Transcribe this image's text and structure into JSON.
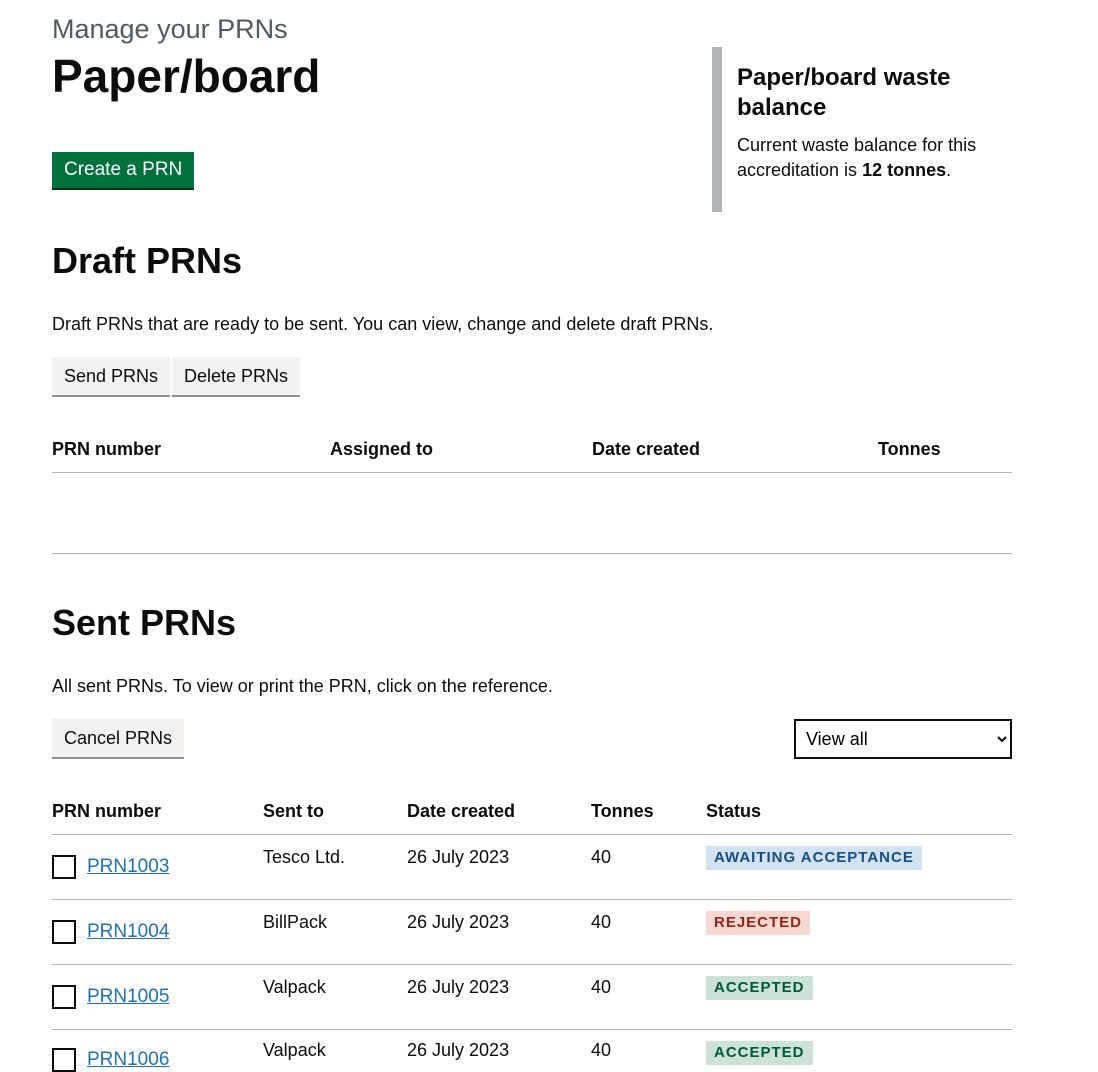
{
  "header": {
    "caption": "Manage your PRNs",
    "title": "Paper/board",
    "create_button": "Create a PRN"
  },
  "balance": {
    "heading": "Paper/board waste balance",
    "text_before": "Current waste balance for this accreditation is ",
    "amount": "12 tonnes",
    "text_after": "."
  },
  "draft": {
    "heading": "Draft PRNs",
    "description": "Draft PRNs that are ready to be sent. You can view, change and delete draft PRNs.",
    "send_button": "Send PRNs",
    "delete_button": "Delete PRNs",
    "columns": [
      "PRN number",
      "Assigned to",
      "Date created",
      "Tonnes"
    ]
  },
  "sent": {
    "heading": "Sent PRNs",
    "description": "All sent PRNs. To view or print the PRN, click on the reference.",
    "cancel_button": "Cancel PRNs",
    "filter_selected": "View all",
    "columns": [
      "PRN number",
      "Sent to",
      "Date created",
      "Tonnes",
      "Status"
    ],
    "rows": [
      {
        "prn": "PRN1003",
        "sent_to": "Tesco Ltd.",
        "date": "26 July 2023",
        "tonnes": "40",
        "status": "AWAITING ACCEPTANCE",
        "status_color": "blue"
      },
      {
        "prn": "PRN1004",
        "sent_to": "BillPack",
        "date": "26 July 2023",
        "tonnes": "40",
        "status": "REJECTED",
        "status_color": "red"
      },
      {
        "prn": "PRN1005",
        "sent_to": "Valpack",
        "date": "26 July 2023",
        "tonnes": "40",
        "status": "ACCEPTED",
        "status_color": "green"
      },
      {
        "prn": "PRN1006",
        "sent_to": "Valpack",
        "date": "26 July 2023",
        "tonnes": "40",
        "status": "ACCEPTED",
        "status_color": "green"
      }
    ]
  },
  "colors": {
    "primary_button": "#00703c",
    "link": "#1d70b8",
    "text": "#0b0c0c"
  }
}
